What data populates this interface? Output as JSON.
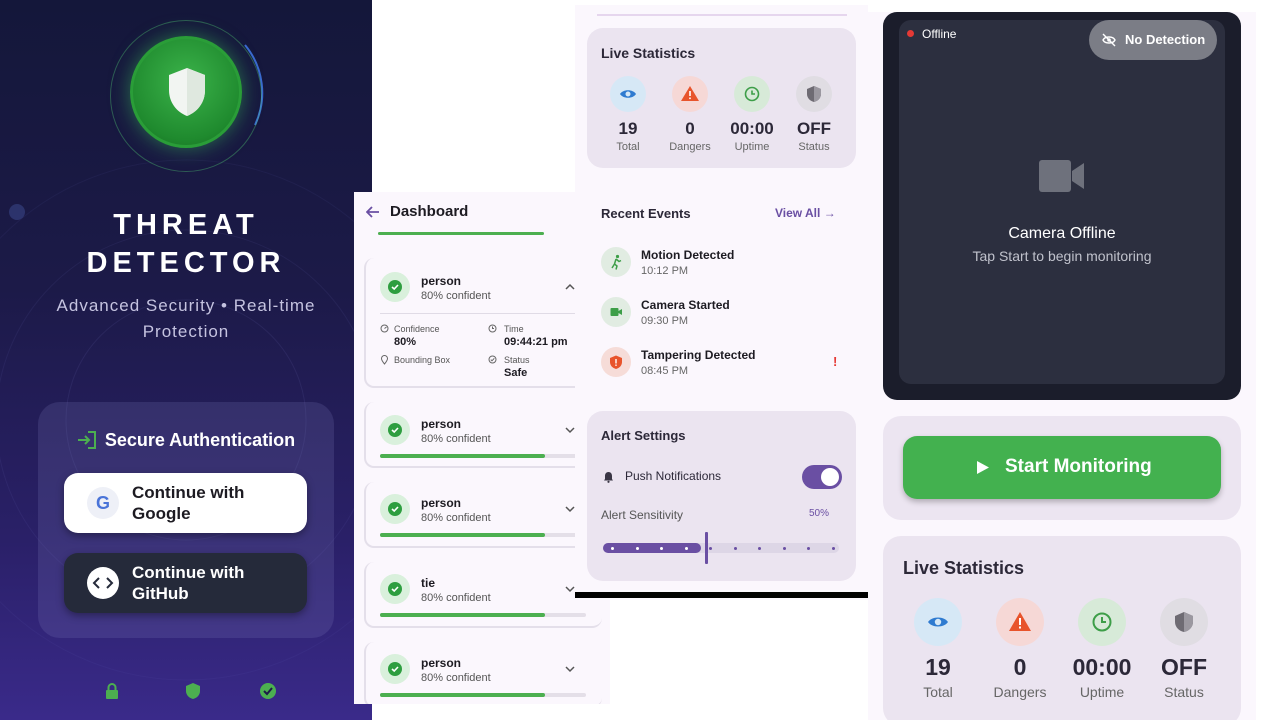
{
  "login": {
    "title_line1": "THREAT",
    "title_line2": "DETECTOR",
    "subtitle": "Advanced Security • Real-time Protection",
    "auth_title": "Secure Authentication",
    "google_letter": "G",
    "google_label": "Continue with Google",
    "github_label": "Continue with GitHub",
    "footer_icons": [
      "lock-icon",
      "shield-icon",
      "verified-icon"
    ],
    "colors": {
      "accent": "#4caf50",
      "background": "#1c1a48"
    }
  },
  "dashboard": {
    "title": "Dashboard",
    "expanded": {
      "name": "person",
      "confidence": "80% confident",
      "confidence_label": "Confidence",
      "confidence_value": "80%",
      "time_label": "Time",
      "time_value": "09:44:21 pm",
      "bbox_label": "Bounding Box",
      "status_label": "Status",
      "status_value": "Safe"
    },
    "detections": [
      {
        "name": "person",
        "confidence": "80% confident",
        "level": 0.8
      },
      {
        "name": "person",
        "confidence": "80% confident",
        "level": 0.8
      },
      {
        "name": "tie",
        "confidence": "80% confident",
        "level": 0.8
      },
      {
        "name": "person",
        "confidence": "80% confident",
        "level": 0.8
      }
    ]
  },
  "stats": {
    "title": "Live Statistics",
    "items": [
      {
        "value": "19",
        "label": "Total",
        "icon": "eye-icon"
      },
      {
        "value": "0",
        "label": "Dangers",
        "icon": "warning-icon"
      },
      {
        "value": "00:00",
        "label": "Uptime",
        "icon": "clock-icon"
      },
      {
        "value": "OFF",
        "label": "Status",
        "icon": "shield-icon"
      }
    ]
  },
  "events": {
    "title": "Recent Events",
    "view_all": "View All",
    "items": [
      {
        "name": "Motion Detected",
        "time": "10:12 PM",
        "icon": "running-icon"
      },
      {
        "name": "Camera Started",
        "time": "09:30 PM",
        "icon": "video-icon"
      },
      {
        "name": "Tampering Detected",
        "time": "08:45 PM",
        "icon": "shield-alert-icon",
        "flag": "!"
      }
    ]
  },
  "alerts": {
    "title": "Alert Settings",
    "push_label": "Push Notifications",
    "push_enabled": true,
    "sensitivity_label": "Alert Sensitivity",
    "sensitivity_value": "50%",
    "sensitivity_level": 0.5
  },
  "camera": {
    "status": "Offline",
    "detection_badge": "No Detection",
    "offline_title": "Camera Offline",
    "offline_hint": "Tap Start to begin monitoring",
    "start_label": "Start Monitoring"
  }
}
